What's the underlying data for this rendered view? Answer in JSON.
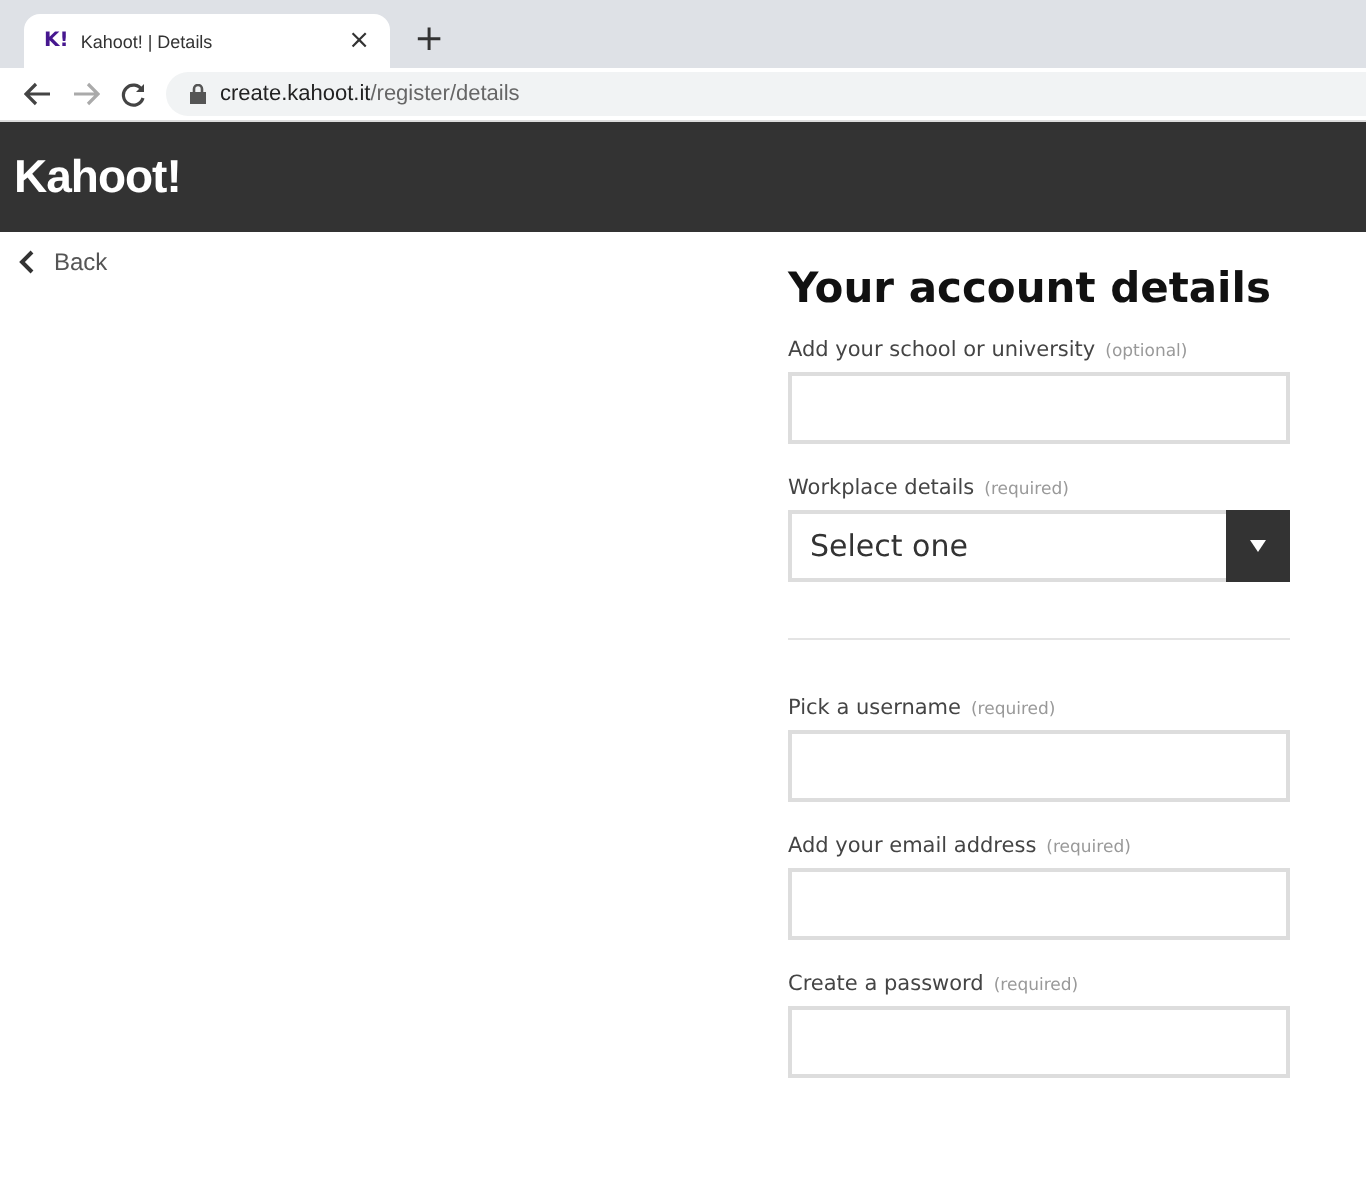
{
  "browser": {
    "tab": {
      "favicon": "K!",
      "title": "Kahoot! | Details",
      "close": "×"
    },
    "new_tab": "+",
    "address": {
      "host": "create.kahoot.it",
      "path": "/register/details"
    }
  },
  "header": {
    "logo": "Kahoot!"
  },
  "back": "Back",
  "title": "Your account details",
  "groups": [
    [
      {
        "kind": "text",
        "label": "Add your school or university",
        "note": "(optional)"
      },
      {
        "kind": "select",
        "label": "Workplace details",
        "note": "(required)",
        "value": "Select one"
      }
    ],
    [
      {
        "kind": "text",
        "label": "Pick a username",
        "note": "(required)"
      },
      {
        "kind": "text",
        "label": "Add your email address",
        "note": "(required)"
      },
      {
        "kind": "text",
        "label": "Create a password",
        "note": "(required)"
      }
    ]
  ]
}
